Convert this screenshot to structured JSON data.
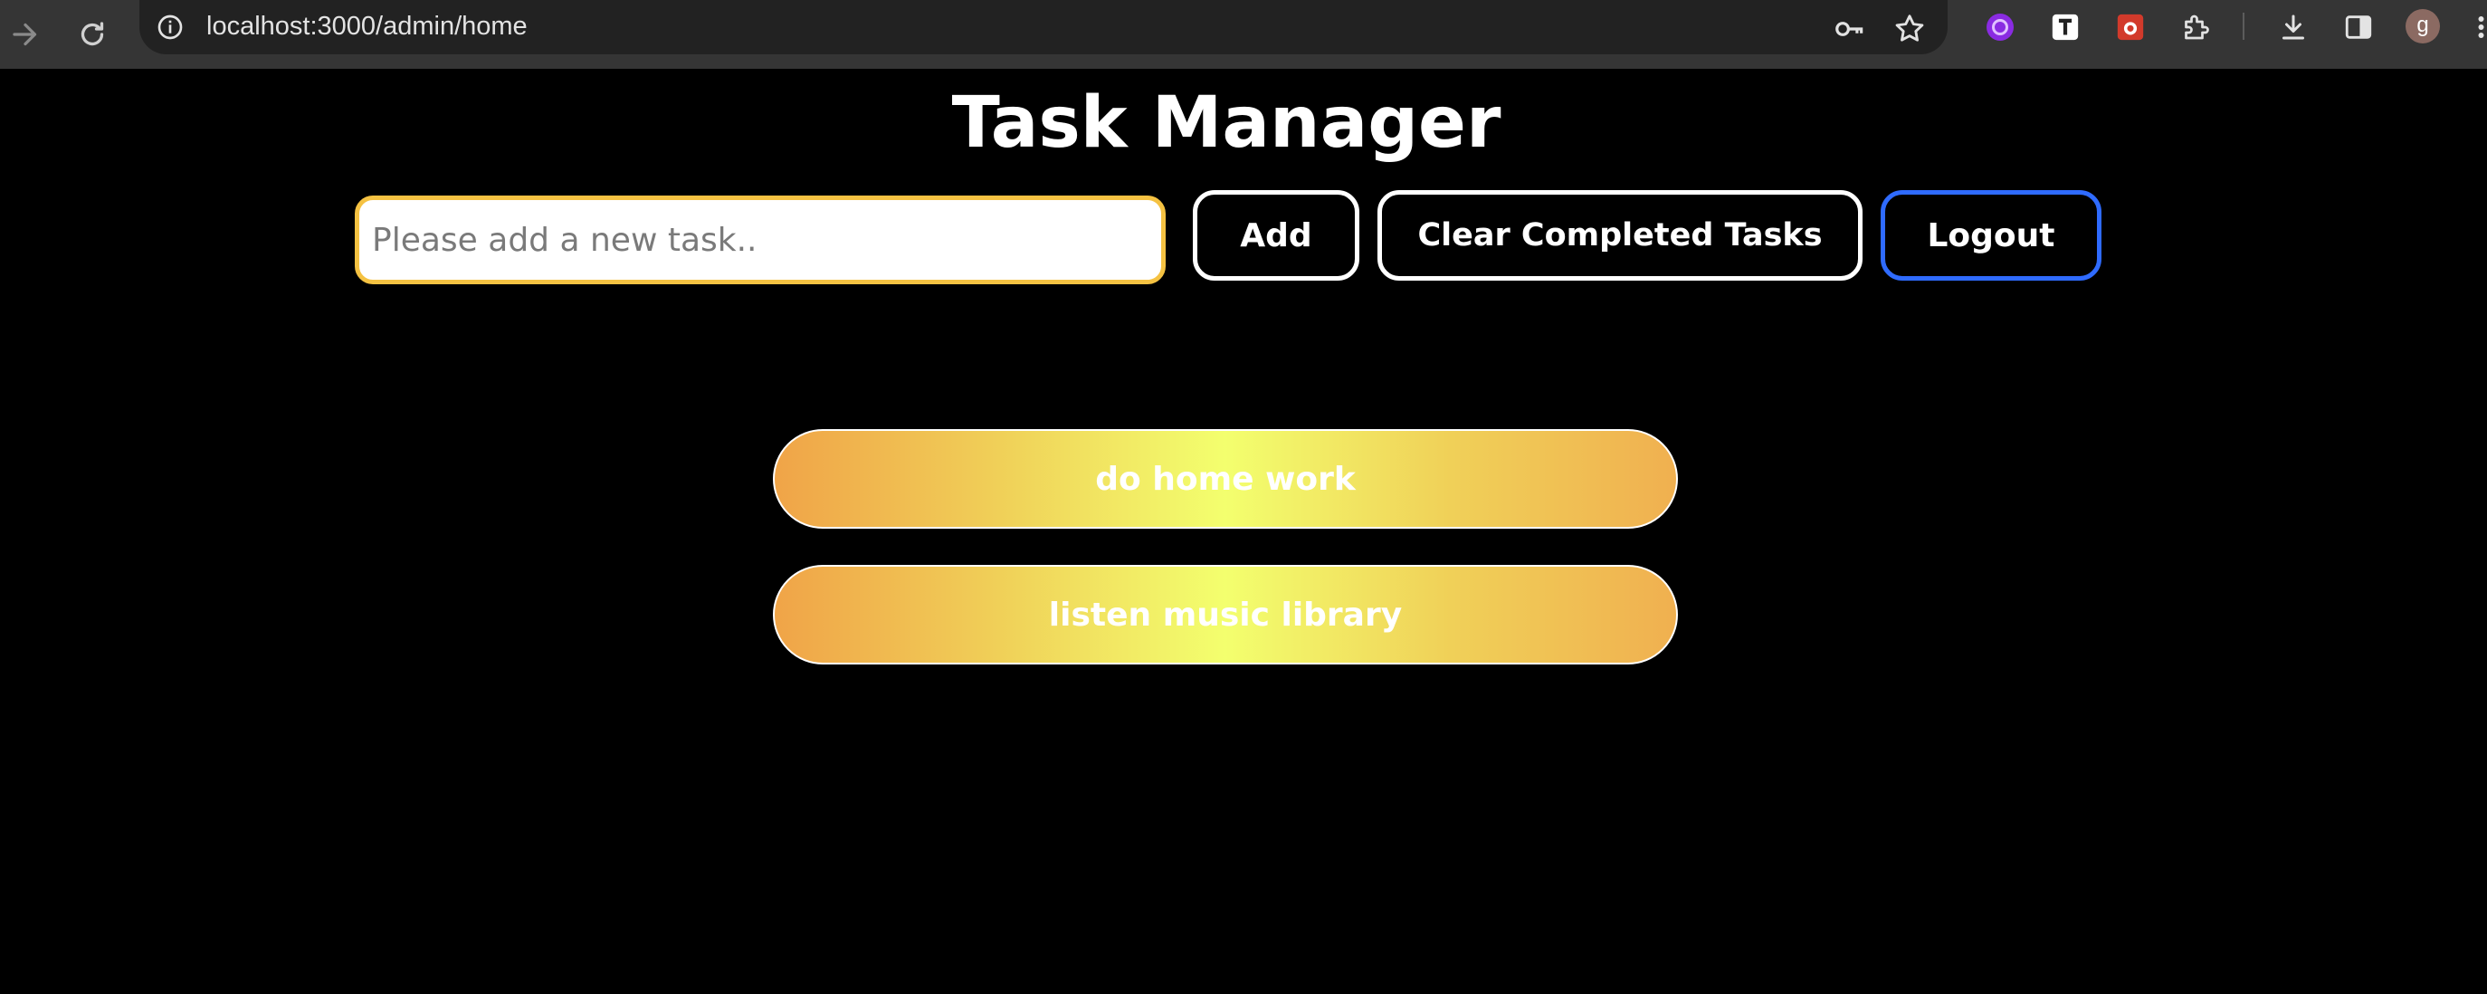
{
  "browser": {
    "url": "localhost:3000/admin/home",
    "avatar_letter": "g",
    "icons": [
      "forward-icon",
      "reload-icon",
      "info-icon",
      "key-icon",
      "star-icon",
      "extension-purple-icon",
      "extension-t-icon",
      "extension-red-icon",
      "puzzle-icon",
      "download-icon",
      "sidepanel-icon",
      "more-icon"
    ]
  },
  "app": {
    "title": "Task Manager",
    "input_placeholder": "Please add a new task..",
    "add_label": "Add",
    "clear_label": "Clear Completed Tasks",
    "logout_label": "Logout",
    "colors": {
      "input_border": "#f5c242",
      "logout_border": "#2f6bff",
      "task_gradient_edge": "#f0a448",
      "task_gradient_center": "#f3ff6e"
    }
  },
  "tasks": [
    {
      "label": "do home work"
    },
    {
      "label": "listen music library"
    }
  ]
}
